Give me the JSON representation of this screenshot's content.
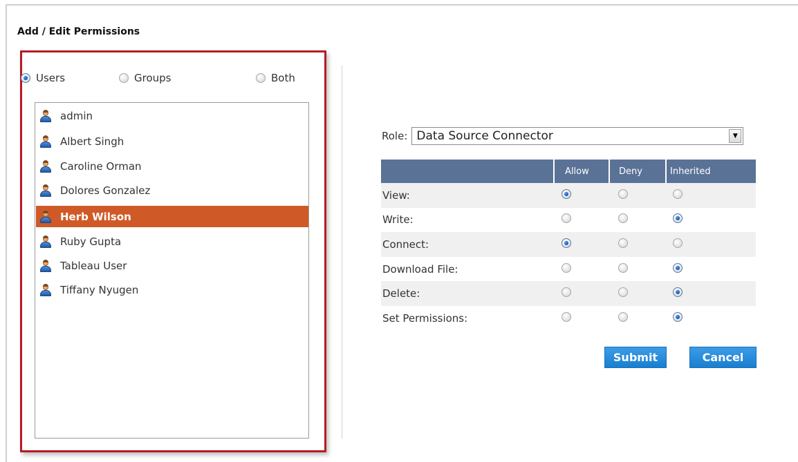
{
  "page": {
    "title": "Add / Edit Permissions"
  },
  "scope": {
    "options": [
      {
        "label": "Users",
        "checked": true
      },
      {
        "label": "Groups",
        "checked": false
      },
      {
        "label": "Both",
        "checked": false
      }
    ]
  },
  "users": {
    "items": [
      {
        "name": "admin",
        "selected": false
      },
      {
        "name": "Albert Singh",
        "selected": false
      },
      {
        "name": "Caroline Orman",
        "selected": false
      },
      {
        "name": "Dolores Gonzalez",
        "selected": false
      },
      {
        "name": "Herb Wilson",
        "selected": true
      },
      {
        "name": "Ruby Gupta",
        "selected": false
      },
      {
        "name": "Tableau User",
        "selected": false
      },
      {
        "name": "Tiffany Nyugen",
        "selected": false
      }
    ],
    "icon": "user-icon"
  },
  "role": {
    "label": "Role:",
    "value": "Data Source Connector"
  },
  "permissions": {
    "columns": [
      "Allow",
      "Deny",
      "Inherited"
    ],
    "rows": [
      {
        "label": "View:",
        "selected": "Allow"
      },
      {
        "label": "Write:",
        "selected": "Inherited"
      },
      {
        "label": "Connect:",
        "selected": "Allow"
      },
      {
        "label": "Download File:",
        "selected": "Inherited"
      },
      {
        "label": "Delete:",
        "selected": "Inherited"
      },
      {
        "label": "Set Permissions:",
        "selected": "Inherited"
      }
    ]
  },
  "actions": {
    "submit_label": "Submit",
    "cancel_label": "Cancel"
  },
  "colors": {
    "selected_row": "#cf5a27",
    "table_header": "#5b7297",
    "button": "#1f86d6",
    "panel_border": "#b51c22"
  }
}
